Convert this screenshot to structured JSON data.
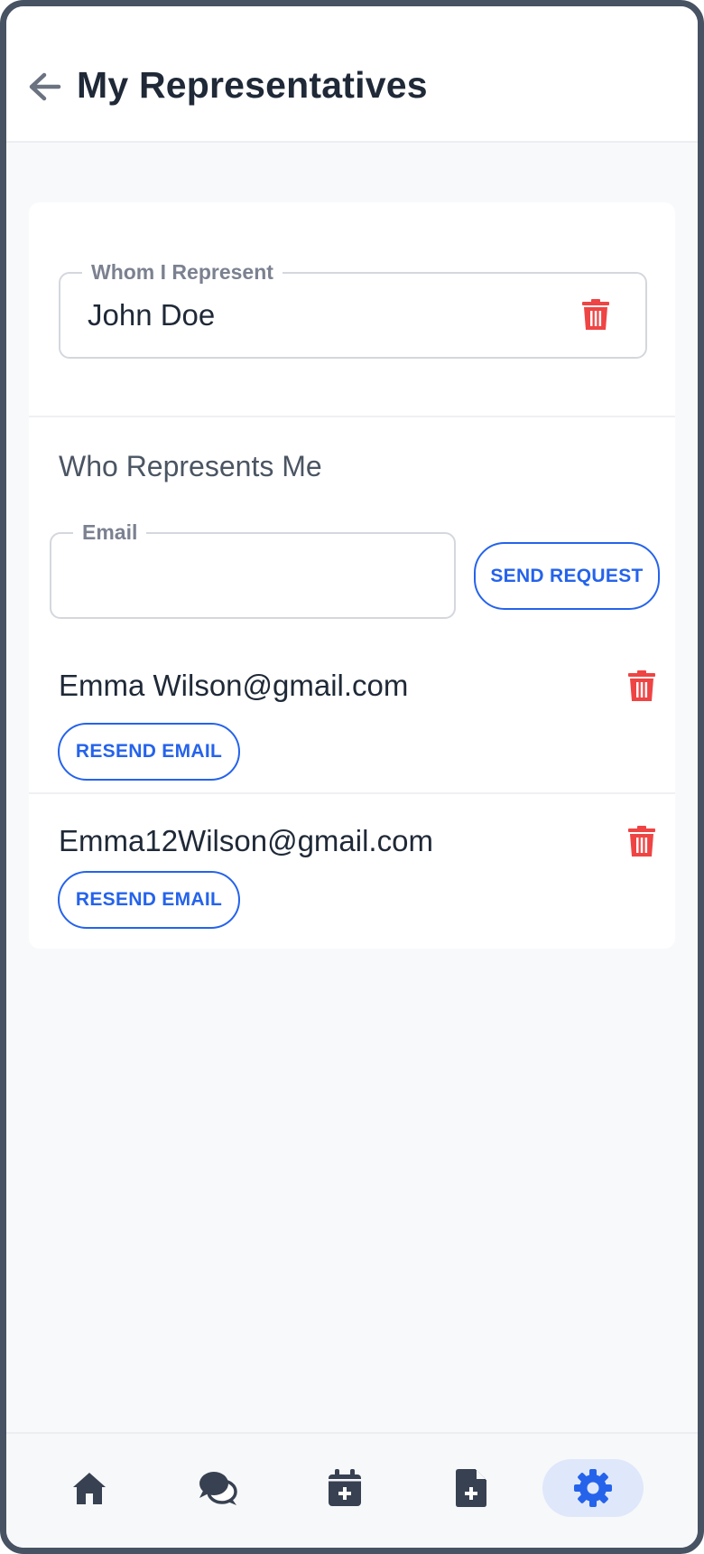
{
  "header": {
    "title": "My Representatives"
  },
  "whom_i_represent": {
    "label": "Whom I Represent",
    "value": "John Doe"
  },
  "who_represents_me": {
    "title": "Who Represents Me",
    "email_label": "Email",
    "email_value": "",
    "send_button": "SEND REQUEST",
    "representatives": [
      {
        "email": "Emma Wilson@gmail.com",
        "resend_label": "RESEND EMAIL"
      },
      {
        "email": "Emma12Wilson@gmail.com",
        "resend_label": "RESEND EMAIL"
      }
    ]
  },
  "bottom_nav": {
    "items": [
      {
        "icon": "home-icon",
        "active": false
      },
      {
        "icon": "chat-icon",
        "active": false
      },
      {
        "icon": "calendar-plus-icon",
        "active": false
      },
      {
        "icon": "file-plus-icon",
        "active": false
      },
      {
        "icon": "gear-icon",
        "active": true
      }
    ]
  },
  "colors": {
    "accent": "#2563eb",
    "danger": "#ef4444",
    "text_dark": "#1f2937",
    "frame": "#475263",
    "nav_active_bg": "#dfe7fa"
  }
}
